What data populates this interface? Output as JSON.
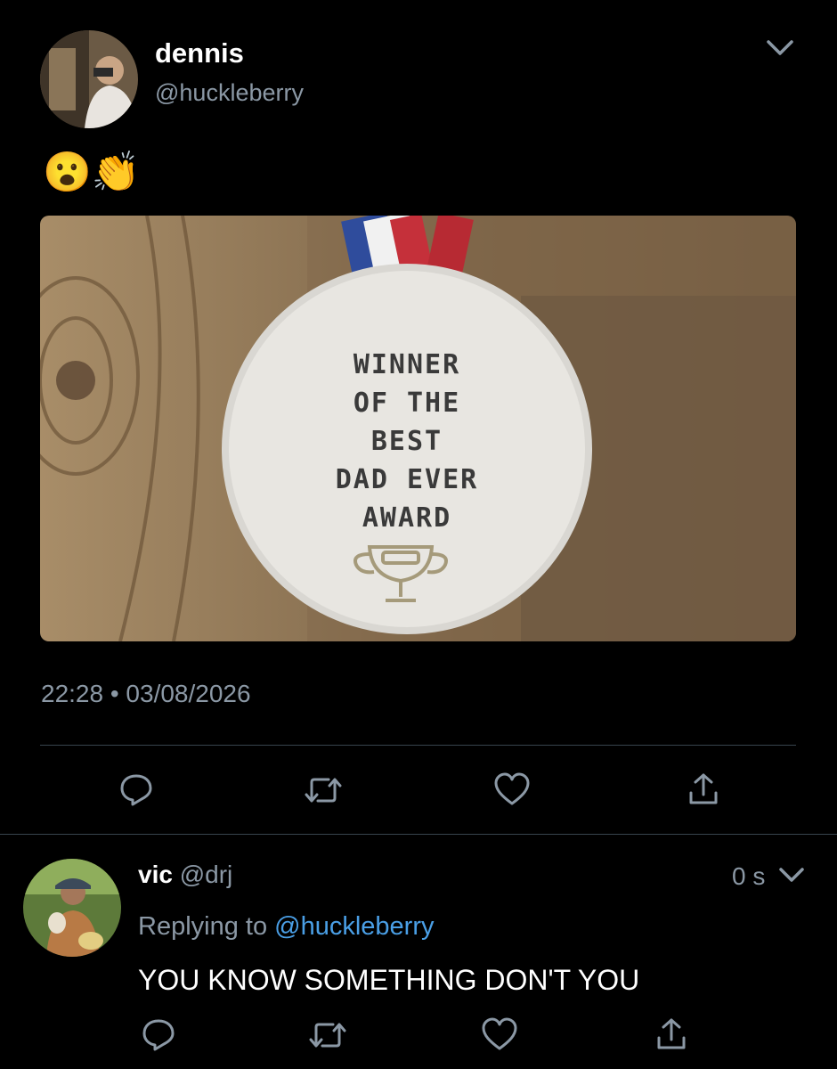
{
  "tweet": {
    "author_name": "dennis",
    "author_handle": "@huckleberry",
    "emoji_text": "😮👏",
    "media": {
      "medal_line1": "WINNER",
      "medal_line2": "OF THE",
      "medal_line3": "BEST",
      "medal_line4": "DAD EVER",
      "medal_line5": "AWARD"
    },
    "timestamp": "22:28 • 03/08/2026",
    "icons": [
      "chevron-down-icon",
      "reply-icon",
      "retweet-icon",
      "like-icon",
      "share-icon"
    ]
  },
  "reply": {
    "author_name": "vic",
    "author_handle": "@drj",
    "age": "0 s",
    "replying_prefix": "Replying to",
    "replying_handle": "@huckleberry",
    "text": "YOU KNOW SOMETHING DON'T YOU"
  },
  "colors": {
    "background": "#000000",
    "muted_text": "#8b98a5",
    "link": "#4a9fe6",
    "divider": "#38444d"
  }
}
